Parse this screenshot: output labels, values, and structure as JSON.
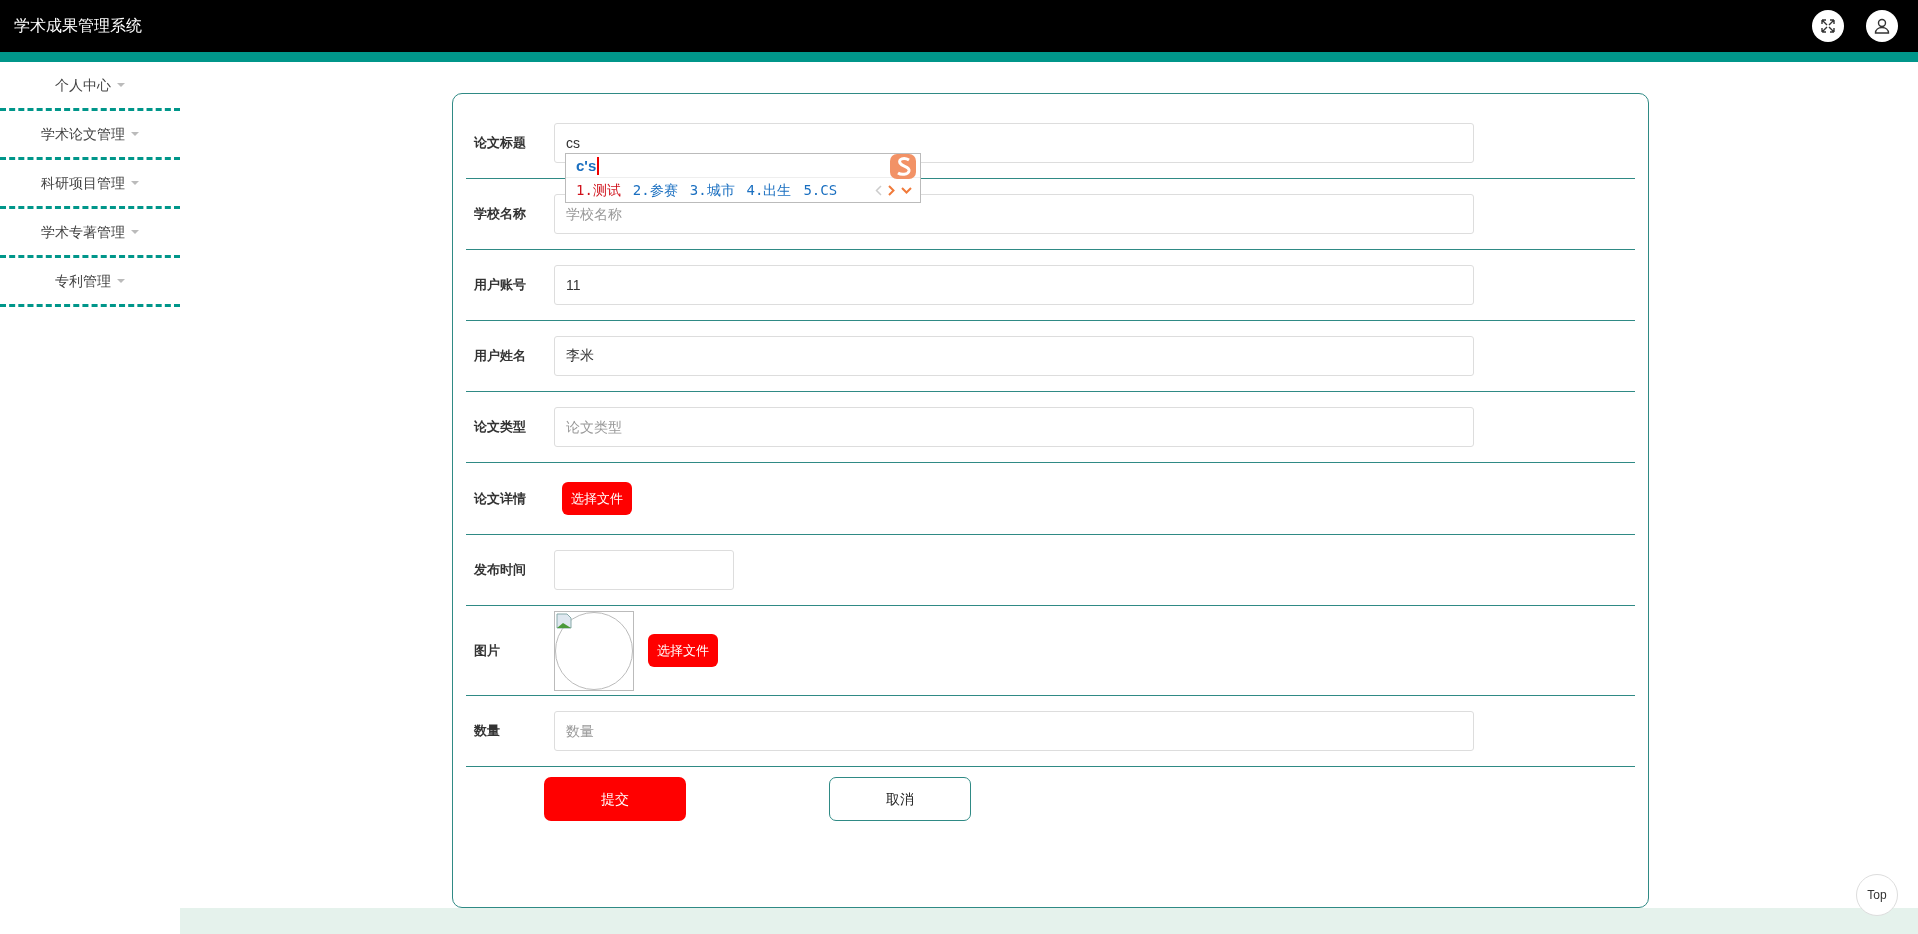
{
  "app": {
    "title": "学术成果管理系统"
  },
  "sidebar": {
    "items": [
      {
        "label": "个人中心"
      },
      {
        "label": "学术论文管理"
      },
      {
        "label": "科研项目管理"
      },
      {
        "label": "学术专著管理"
      },
      {
        "label": "专利管理"
      }
    ]
  },
  "form": {
    "fields": [
      {
        "kind": "text",
        "label": "论文标题",
        "value": "cs"
      },
      {
        "kind": "text",
        "label": "学校名称",
        "placeholder": "学校名称"
      },
      {
        "kind": "text",
        "label": "用户账号",
        "value": "11"
      },
      {
        "kind": "text",
        "label": "用户姓名",
        "value": "李米"
      },
      {
        "kind": "text",
        "label": "论文类型",
        "placeholder": "论文类型"
      },
      {
        "kind": "file",
        "label": "论文详情",
        "button": "选择文件"
      },
      {
        "kind": "date",
        "label": "发布时间"
      },
      {
        "kind": "image",
        "label": "图片",
        "button": "选择文件"
      },
      {
        "kind": "text",
        "label": "数量",
        "placeholder": "数量"
      }
    ],
    "buttons": [
      {
        "kind": "primary",
        "label": "提交"
      },
      {
        "kind": "secondary",
        "label": "取消"
      }
    ]
  },
  "ime": {
    "composition": "c's",
    "candidates": [
      {
        "label": "1.测试",
        "selected": true
      },
      {
        "label": "2.参赛",
        "selected": false
      },
      {
        "label": "3.城市",
        "selected": false
      },
      {
        "label": "4.出生",
        "selected": false
      },
      {
        "label": "5.CS",
        "selected": false
      }
    ]
  },
  "back_to_top": {
    "label": "Top"
  }
}
